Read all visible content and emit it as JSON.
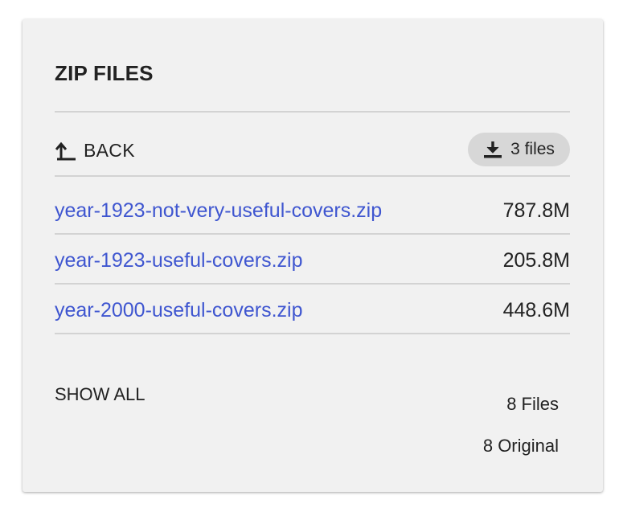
{
  "panel": {
    "title": "ZIP FILES"
  },
  "toolbar": {
    "back_label": "BACK",
    "back_icon": "back-arrow-icon",
    "download_label": "3 files",
    "download_icon": "download-icon"
  },
  "files": [
    {
      "name": "year-1923-not-very-useful-covers.zip",
      "size": "787.8M"
    },
    {
      "name": "year-1923-useful-covers.zip",
      "size": "205.8M"
    },
    {
      "name": "year-2000-useful-covers.zip",
      "size": "448.6M"
    }
  ],
  "footer": {
    "show_all_label": "SHOW ALL",
    "files_count": "8 Files",
    "original_count": "8 Original"
  },
  "colors": {
    "panel_bg": "#f1f1f1",
    "link": "#3f56d0",
    "pill_bg": "#d7d7d7",
    "divider": "#d3d3d3",
    "text": "#222222"
  }
}
